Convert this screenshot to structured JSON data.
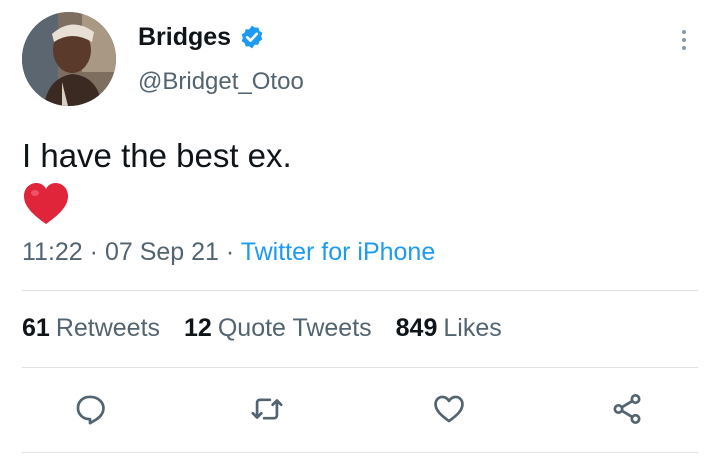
{
  "author": {
    "display_name": "Bridges",
    "handle": "@Bridget_Otoo",
    "verified": true,
    "verified_color": "#1d9bf0"
  },
  "tweet": {
    "text": "I have the best ex.",
    "emoji": "red-heart-emoji"
  },
  "meta": {
    "time": "11:22",
    "sep1": " · ",
    "date": "07 Sep 21",
    "sep2": " · ",
    "source": "Twitter for iPhone"
  },
  "stats": {
    "retweets_count": "61",
    "retweets_label": "Retweets",
    "quotes_count": "12",
    "quotes_label": "Quote Tweets",
    "likes_count": "849",
    "likes_label": "Likes"
  },
  "colors": {
    "text_primary": "#0f1419",
    "text_secondary": "#536471",
    "link": "#1d9bf0",
    "heart": "#e0243a"
  },
  "icons": [
    "more-icon",
    "reply-icon",
    "retweet-icon",
    "like-icon",
    "share-icon"
  ]
}
